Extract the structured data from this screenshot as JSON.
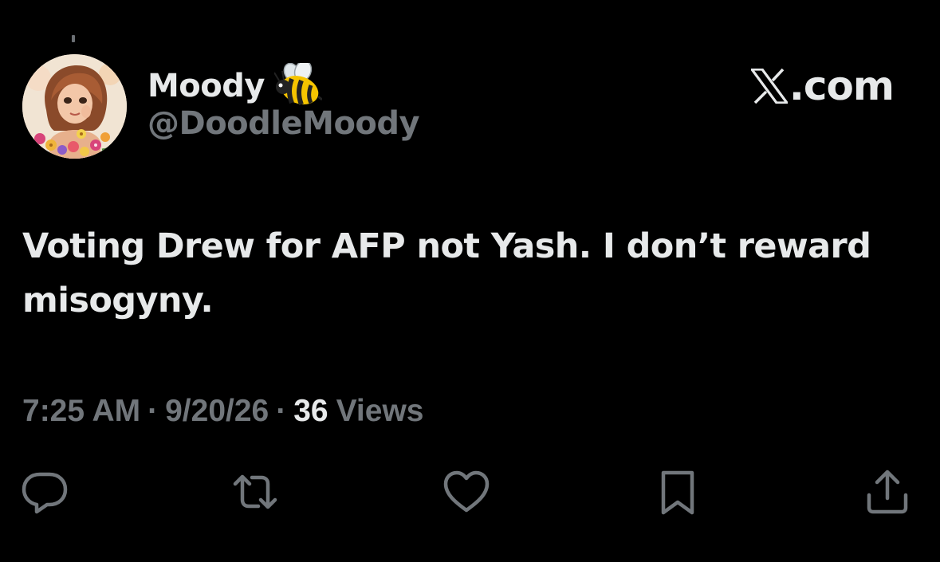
{
  "author": {
    "display_name": "Moody",
    "handle": "@DoodleMoody",
    "name_emoji": "bee-icon",
    "avatar": "avatar-illustration"
  },
  "brand": {
    "logo": "x-logo-icon",
    "suffix": ".com"
  },
  "tweet": {
    "text": "Voting Drew for AFP not Yash. I don’t reward misogyny."
  },
  "meta": {
    "time": "7:25 AM",
    "separator": "·",
    "date": "9/20/26",
    "views_count": "36",
    "views_label": "Views"
  },
  "actions": [
    {
      "name": "reply",
      "icon": "reply-icon"
    },
    {
      "name": "repost",
      "icon": "repost-icon"
    },
    {
      "name": "like",
      "icon": "heart-icon"
    },
    {
      "name": "bookmark",
      "icon": "bookmark-icon"
    },
    {
      "name": "share",
      "icon": "share-icon"
    }
  ],
  "colors": {
    "background": "#000000",
    "primary_text": "#e7e9ea",
    "secondary_text": "#71767b"
  }
}
